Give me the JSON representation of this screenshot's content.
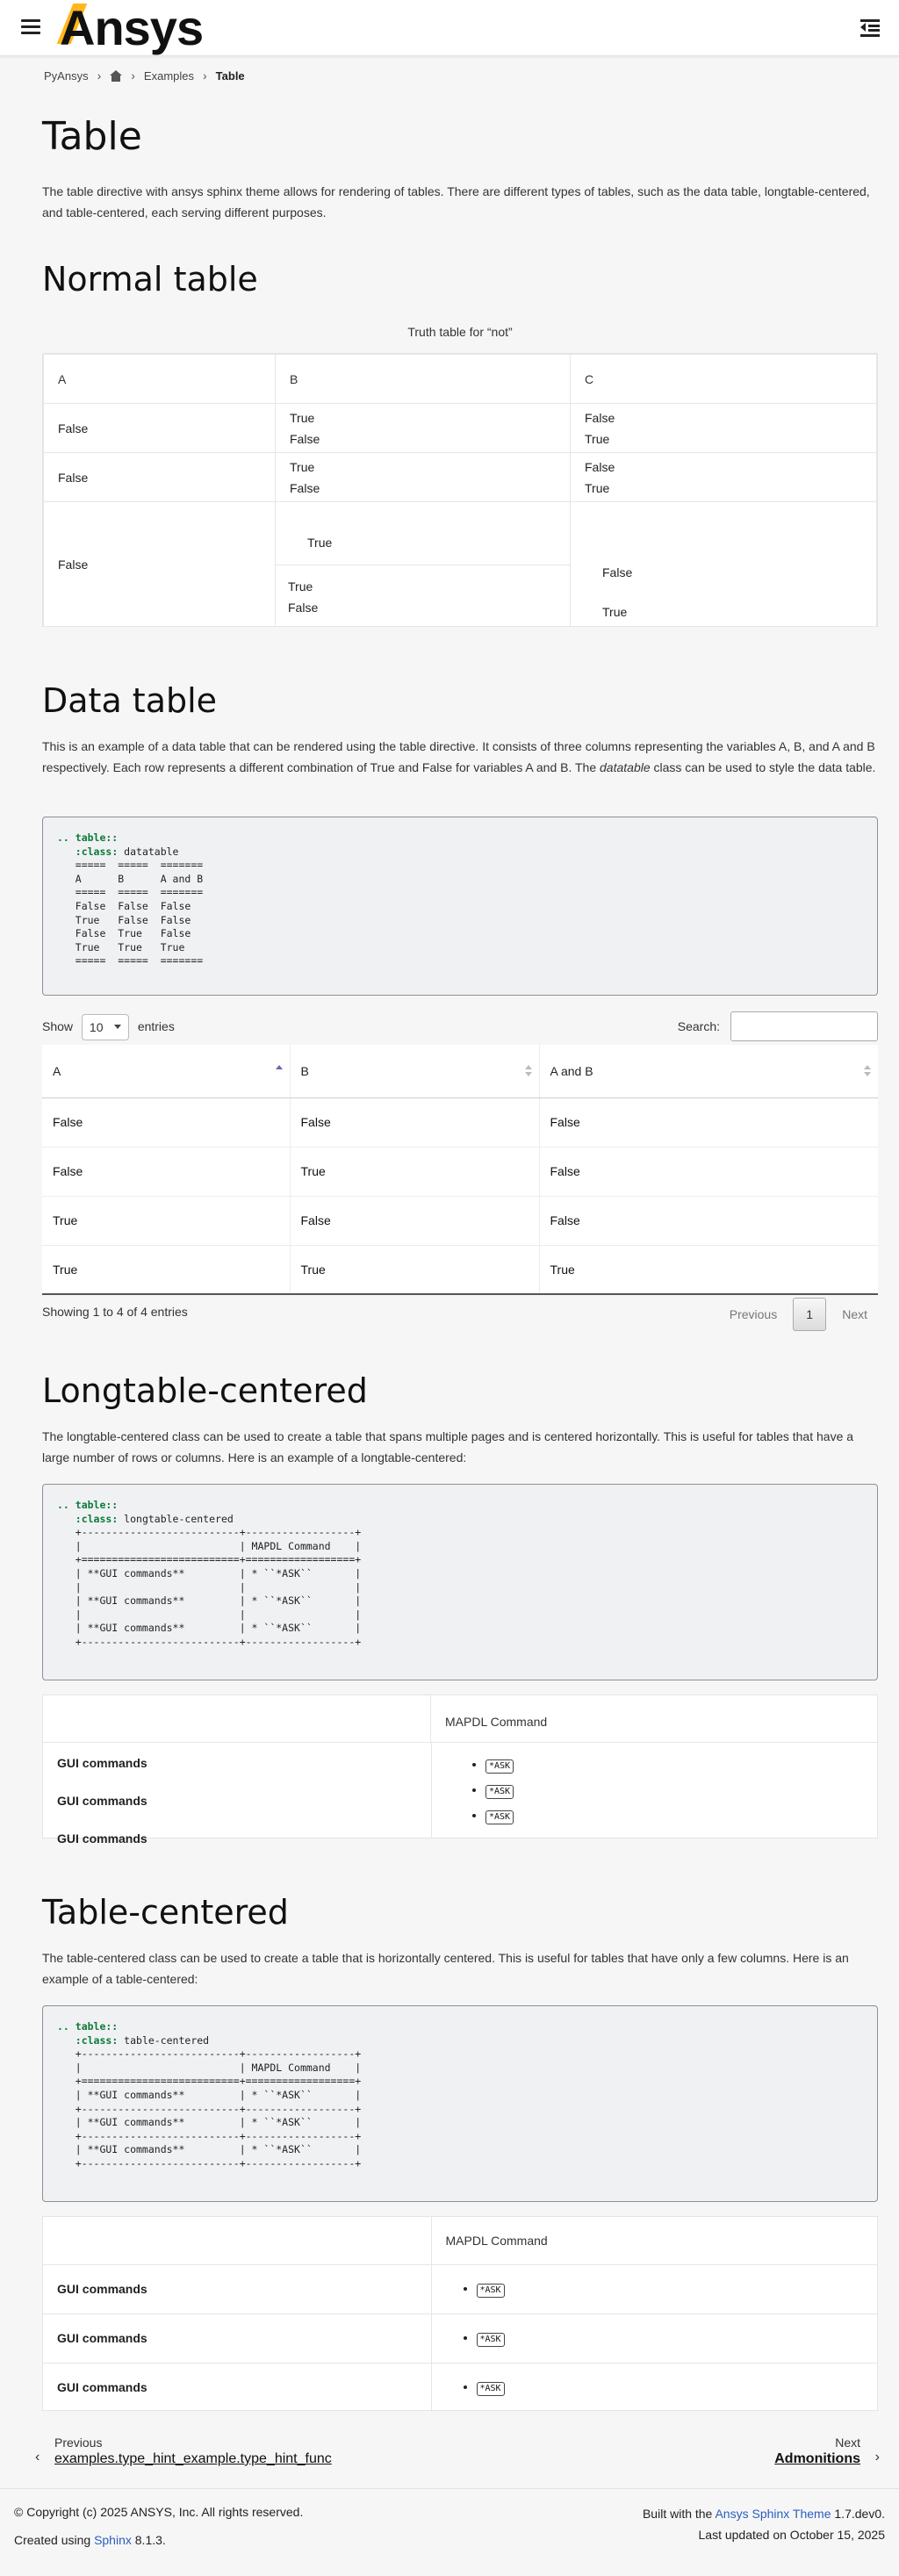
{
  "header": {
    "logo_a": "A",
    "logo_rest": "nsys"
  },
  "breadcrumb": {
    "root": "PyAnsys",
    "examples": "Examples",
    "current": "Table"
  },
  "intro": {
    "title": "Table",
    "text": "The table directive with ansys sphinx theme allows for rendering of tables. There are different types of tables, such as the data table, longtable-centered, and table-centered, each serving different purposes."
  },
  "normal_table": {
    "heading": "Normal table",
    "caption": "Truth table for “not”",
    "columns": [
      "A",
      "B",
      "C"
    ],
    "rows": [
      {
        "a": "False",
        "b": [
          "True",
          "False"
        ],
        "c": [
          "False",
          "True"
        ]
      },
      {
        "a": "False",
        "b": [
          "True",
          "False"
        ],
        "c": [
          "False",
          "True"
        ]
      }
    ],
    "row3": {
      "a": "False",
      "b_inner": "True",
      "b_lines": [
        "True",
        "False"
      ],
      "c_top": "False",
      "c_bottom": "True"
    }
  },
  "data_table": {
    "heading": "Data table",
    "text_before_em": "This is an example of a data table that can be rendered using the table directive. It consists of three columns representing the variables A, B, and A and B respectively. Each row represents a different combination of True and False for variables A and B. The ",
    "em": "datatable",
    "text_after_em": " class can be used to style the data table.",
    "code": {
      "directive": ".. table::",
      "option": ":class:",
      "option_value": " datatable",
      "body": "\n   =====  =====  =======\n   A      B      A and B\n   =====  =====  =======\n   False  False  False\n   True   False  False\n   False  True   False\n   True   True   True\n   =====  =====  ======="
    },
    "show_label": "Show",
    "entries_value": "10",
    "entries_label": "entries",
    "search_label": "Search:",
    "columns": [
      "A",
      "B",
      "A and B"
    ],
    "rows": [
      [
        "False",
        "False",
        "False"
      ],
      [
        "False",
        "True",
        "False"
      ],
      [
        "True",
        "False",
        "False"
      ],
      [
        "True",
        "True",
        "True"
      ]
    ],
    "info": "Showing 1 to 4 of 4 entries",
    "pager": {
      "previous": "Previous",
      "current": "1",
      "next": "Next"
    }
  },
  "longtable": {
    "heading": "Longtable-centered",
    "text": "The longtable-centered class can be used to create a table that spans multiple pages and is centered horizontally. This is useful for tables that have a large number of rows or columns. Here is an example of a longtable-centered:",
    "code": {
      "directive": ".. table::",
      "option": ":class:",
      "option_value": " longtable-centered",
      "body": "\n   +--------------------------+------------------+\n   |                          | MAPDL Command    |\n   +==========================+==================+\n   | **GUI commands**         | * ``*ASK``       |\n   |                          |                  |\n   | **GUI commands**         | * ``*ASK``       |\n   |                          |                  |\n   | **GUI commands**         | * ``*ASK``       |\n   +--------------------------+------------------+"
    },
    "col_header": "MAPDL Command",
    "rows": [
      "GUI commands",
      "GUI commands",
      "GUI commands"
    ],
    "badge": "*ASK"
  },
  "centered": {
    "heading": "Table-centered",
    "text": "The table-centered class can be used to create a table that is horizontally centered. This is useful for tables that have only a few columns. Here is an example of a table-centered:",
    "code": {
      "directive": ".. table::",
      "option": ":class:",
      "option_value": " table-centered",
      "body": "\n   +--------------------------+------------------+\n   |                          | MAPDL Command    |\n   +==========================+==================+\n   | **GUI commands**         | * ``*ASK``       |\n   +--------------------------+------------------+\n   | **GUI commands**         | * ``*ASK``       |\n   +--------------------------+------------------+\n   | **GUI commands**         | * ``*ASK``       |\n   +--------------------------+------------------+"
    },
    "col_header": "MAPDL Command",
    "rows": [
      "GUI commands",
      "GUI commands",
      "GUI commands"
    ],
    "badge": "*ASK"
  },
  "nav": {
    "prev_label": "Previous",
    "prev_title": "examples.type_hint_example.type_hint_func",
    "next_label": "Next",
    "next_title": "Admonitions"
  },
  "footer": {
    "copyright": "© Copyright (c) 2025 ANSYS, Inc. All rights reserved.",
    "created_prefix": "Created using ",
    "sphinx_link": "Sphinx",
    "sphinx_version": " 8.1.3.",
    "built_prefix": "Built with the ",
    "theme_link": "Ansys Sphinx Theme",
    "theme_version": " 1.7.dev0.",
    "updated": "Last updated on October 15, 2025"
  }
}
